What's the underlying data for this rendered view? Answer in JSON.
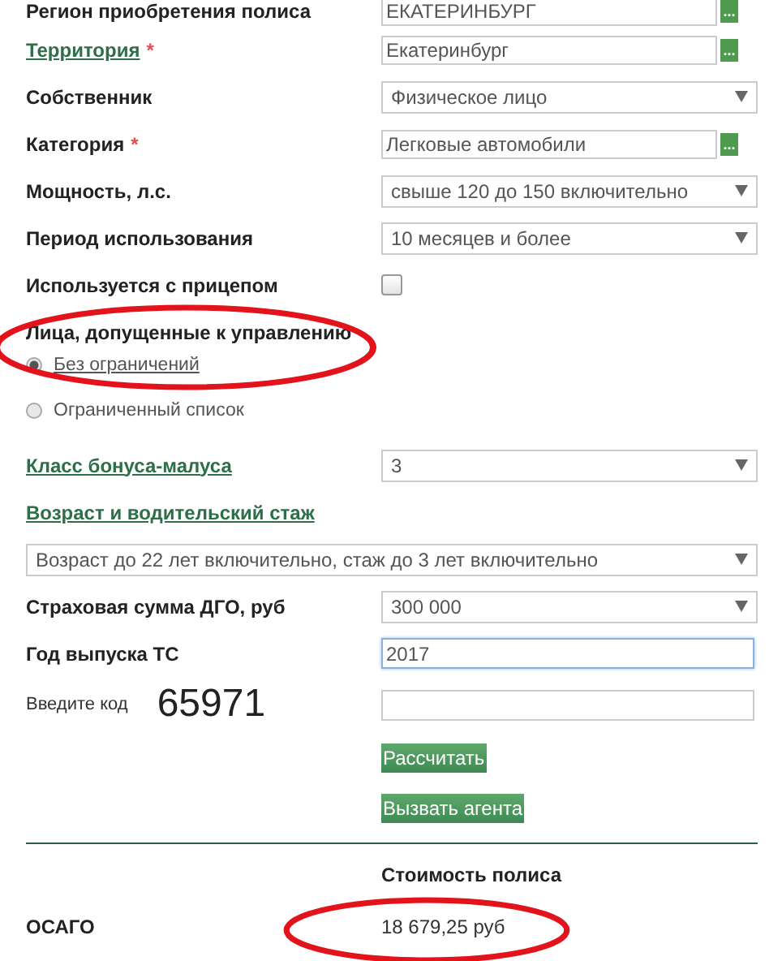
{
  "fields": [
    {
      "kind": "lookup",
      "label": "Регион приобретения полиса",
      "link": false,
      "value": "ЕКАТЕРИНБУРГ",
      "button": "..."
    },
    {
      "kind": "lookup",
      "label": "Территория",
      "link": true,
      "required_mark": "*",
      "value": "Екатеринбург",
      "button": "..."
    },
    {
      "kind": "select",
      "label": "Собственник",
      "link": false,
      "value": "Физическое лицо"
    },
    {
      "kind": "lookup",
      "label": "Категория",
      "link": false,
      "required_mark": "*",
      "value": "Легковые автомобили",
      "button": "..."
    },
    {
      "kind": "select",
      "label": "Мощность, л.с.",
      "link": false,
      "value": "свыше 120 до 150 включительно"
    },
    {
      "kind": "select",
      "label": "Период использования",
      "link": false,
      "value": "10 месяцев и более"
    },
    {
      "kind": "checkbox",
      "label": "Используется с прицепом",
      "link": false,
      "checked": false
    }
  ],
  "drivers": {
    "label": "Лица, допущенные к управлению",
    "highlighted": true,
    "options": [
      {
        "label": "Без ограничений",
        "selected": true
      },
      {
        "label": "Ограниченный список",
        "selected": false
      }
    ]
  },
  "fields2": [
    {
      "kind": "select",
      "label": "Класс бонуса-малуса",
      "link": true,
      "value": "3"
    },
    {
      "kind": "heading",
      "label": "Возраст и водительский стаж",
      "link": true
    },
    {
      "kind": "wide-select",
      "value": "Возраст до 22 лет включительно, стаж до 3 лет включительно"
    },
    {
      "kind": "select",
      "label": "Страховая сумма ДГО, руб",
      "link": false,
      "value": "300 000"
    },
    {
      "kind": "text",
      "label": "Год выпуска ТС",
      "link": false,
      "value": "2017",
      "focused": true
    }
  ],
  "captcha": {
    "label": "Введите код",
    "code": "65971"
  },
  "buttons": [
    "Рассчитать",
    "Вызвать агента"
  ],
  "result": {
    "header": "Стоимость полиса",
    "label": "ОСАГО",
    "price": "18 679,25 руб",
    "highlighted": true
  }
}
